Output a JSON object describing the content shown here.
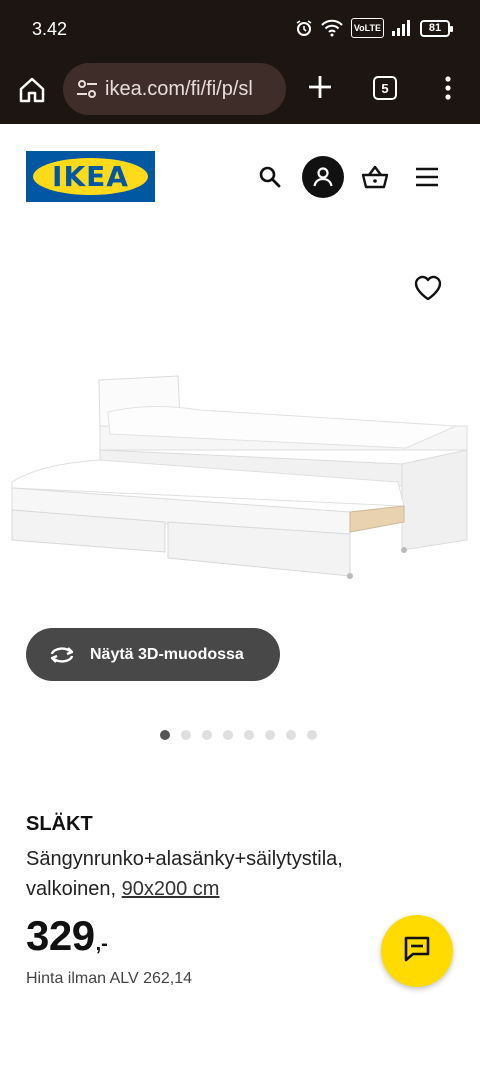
{
  "status_bar": {
    "time": "3.42",
    "network_badge": "VoLTE",
    "battery": "81",
    "icons": [
      "alarm-icon",
      "wifi-icon",
      "volte-icon",
      "signal-icon",
      "battery-icon"
    ]
  },
  "browser": {
    "url": "ikea.com/fi/fi/p/sl",
    "tab_count": "5",
    "icons": [
      "home-icon",
      "tune-icon",
      "plus-icon",
      "tabs-icon",
      "kebab-menu-icon"
    ]
  },
  "header": {
    "logo_text": "IKEA",
    "icons": [
      "search-icon",
      "profile-icon",
      "basket-icon",
      "hamburger-menu-icon"
    ]
  },
  "gallery": {
    "view3d_label": "Näytä 3D-muodossa",
    "dot_count": 8,
    "active_dot": 0
  },
  "product": {
    "name": "SLÄKT",
    "description": "Sängynrunko+alasänky+säilytystila, valkoinen, ",
    "size": "90x200 cm",
    "price_integer": "329",
    "price_suffix": ",-",
    "price_vat": "Hinta ilman ALV 262,14"
  },
  "colors": {
    "ikea_blue": "#0058a3",
    "ikea_yellow": "#ffda1a",
    "chat_yellow": "#ffdb00",
    "browser_bar": "#1d1512"
  }
}
